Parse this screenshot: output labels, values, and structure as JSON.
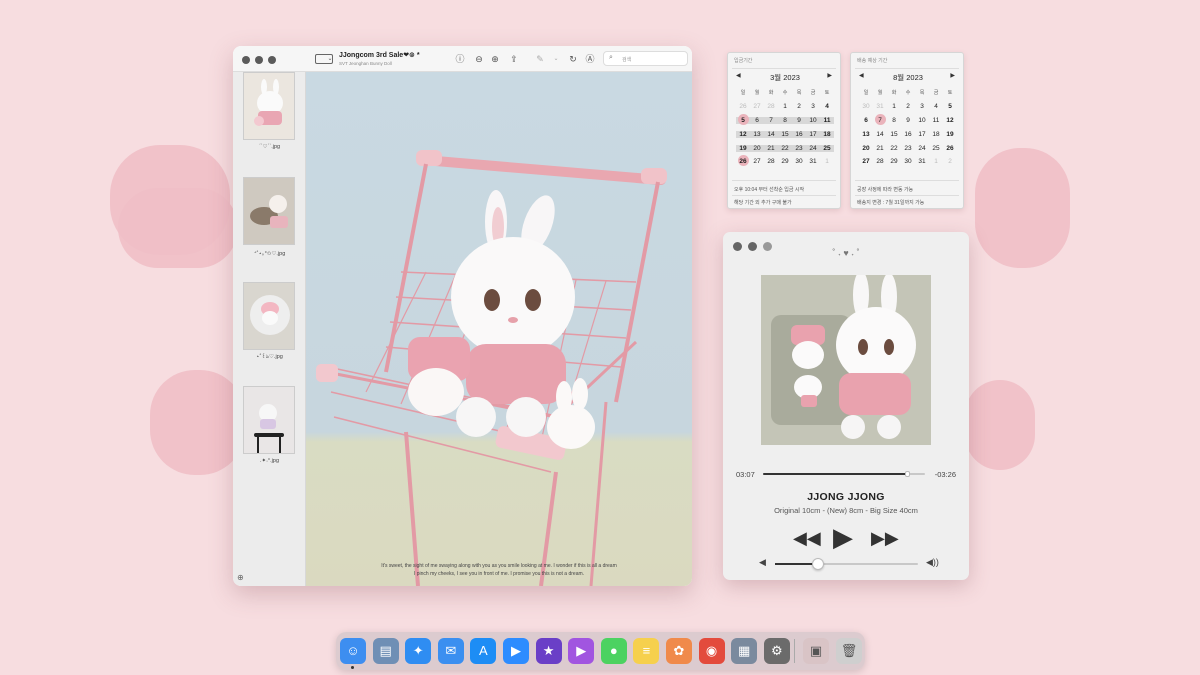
{
  "preview": {
    "title": "JJongcom 3rd Sale❤︎⊚ *",
    "subtitle": "SVT Jeonghan Bunny Doll",
    "search_placeholder": "검색",
    "thumbnails": [
      {
        "label": "ˊˋ♡ˊˋ.jpg"
      },
      {
        "label": "⁺˚⋆｡°✩♡.jpg"
      },
      {
        "label": "⋆˚꒰ঌ♡.jpg"
      },
      {
        "label": ".✦˖°.jpg"
      }
    ],
    "caption_line1": "It's sweet, the sight of me swaying along with you as you smile looking at me. I wonder if this is all a dream",
    "caption_line2": "I pinch my cheeks, I see you in front of me. I promise you this is not a dream."
  },
  "calendar_left": {
    "header": "입금기간",
    "month": "3월 2023",
    "weekdays": [
      "일",
      "월",
      "화",
      "수",
      "목",
      "금",
      "토"
    ],
    "weeks": [
      [
        "26",
        "27",
        "28",
        "1",
        "2",
        "3",
        "4"
      ],
      [
        "5",
        "6",
        "7",
        "8",
        "9",
        "10",
        "11"
      ],
      [
        "12",
        "13",
        "14",
        "15",
        "16",
        "17",
        "18"
      ],
      [
        "19",
        "20",
        "21",
        "22",
        "23",
        "24",
        "25"
      ],
      [
        "26",
        "27",
        "28",
        "29",
        "30",
        "31",
        "1"
      ]
    ],
    "note1": "오후 10:04 부터 선착순 입금 시작",
    "note2": "해당 기간 외 추가 구매 불가"
  },
  "calendar_right": {
    "header": "배송 예상 기간",
    "month": "8월 2023",
    "weekdays": [
      "일",
      "월",
      "화",
      "수",
      "목",
      "금",
      "토"
    ],
    "weeks": [
      [
        "30",
        "31",
        "1",
        "2",
        "3",
        "4",
        "5"
      ],
      [
        "6",
        "7",
        "8",
        "9",
        "10",
        "11",
        "12"
      ],
      [
        "13",
        "14",
        "15",
        "16",
        "17",
        "18",
        "19"
      ],
      [
        "20",
        "21",
        "22",
        "23",
        "24",
        "25",
        "26"
      ],
      [
        "27",
        "28",
        "29",
        "30",
        "31",
        "1",
        "2"
      ]
    ],
    "note1": "공장 사정에 따라 변동 가능",
    "note2": "배송지 변경 : 7월 31일까지 가능"
  },
  "player": {
    "deco": "˚ ˖ ♥ ˖ ˚",
    "elapsed": "03:07",
    "remaining": "-03:26",
    "progress": 0.89,
    "volume": 0.3,
    "track_title": "JJONG JJONG",
    "track_subtitle": "Original 10cm - (New) 8cm - Big Size 40cm"
  },
  "dock": {
    "apps": [
      {
        "name": "finder-icon",
        "glyph": "☺",
        "color": "#3d8ef0"
      },
      {
        "name": "preview-app-icon",
        "glyph": "▤",
        "color": "#6f8fb5"
      },
      {
        "name": "safari-icon",
        "glyph": "✦",
        "color": "#2f8df2"
      },
      {
        "name": "mail-icon",
        "glyph": "✉",
        "color": "#3b8ff0"
      },
      {
        "name": "app-store-icon",
        "glyph": "A",
        "color": "#1d8df5"
      },
      {
        "name": "zoom-icon",
        "glyph": "▶",
        "color": "#2d8cff"
      },
      {
        "name": "imovie-icon",
        "glyph": "★",
        "color": "#6a3fc7"
      },
      {
        "name": "itunes-icon",
        "glyph": "▶",
        "color": "#a155e0"
      },
      {
        "name": "messages-icon",
        "glyph": "●",
        "color": "#4cd261"
      },
      {
        "name": "notes-icon",
        "glyph": "≡",
        "color": "#f6d04d"
      },
      {
        "name": "photos-icon",
        "glyph": "✿",
        "color": "#f08a4b"
      },
      {
        "name": "chrome-icon",
        "glyph": "◉",
        "color": "#e34b3d"
      },
      {
        "name": "launchpad-icon",
        "glyph": "▦",
        "color": "#7a8a9e"
      },
      {
        "name": "system-settings-icon",
        "glyph": "⚙",
        "color": "#6b6b6b"
      }
    ],
    "extra": [
      {
        "name": "photo-stack-icon",
        "glyph": "▣",
        "color": "#d9c4c6"
      },
      {
        "name": "trash-icon",
        "glyph": "🗑",
        "color": "#cfcfcf"
      }
    ]
  }
}
